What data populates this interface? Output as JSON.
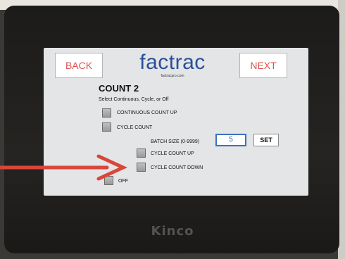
{
  "header": {
    "back_label": "BACK",
    "next_label": "NEXT",
    "logo_text": "factrac",
    "logo_url": "factracpro.com"
  },
  "page": {
    "title": "COUNT 2",
    "subtitle": "Select Continuous, Cycle, or Off"
  },
  "options": {
    "continuous_count_up": "CONTINUOUS COUNT UP",
    "cycle_count": "CYCLE COUNT",
    "batch_size_label": "BATCH SIZE (0-9999)",
    "batch_size_value": "5",
    "set_label": "SET",
    "cycle_count_up": "CYCLE COUNT UP",
    "cycle_count_down": "CYCLE COUNT DOWN",
    "off": "OFF"
  },
  "device": {
    "brand": "Kinco"
  },
  "colors": {
    "accent_red": "#d9534f",
    "logo_blue": "#2a4f9a",
    "input_border_blue": "#3a73b9",
    "arrow": "#d9463a"
  }
}
